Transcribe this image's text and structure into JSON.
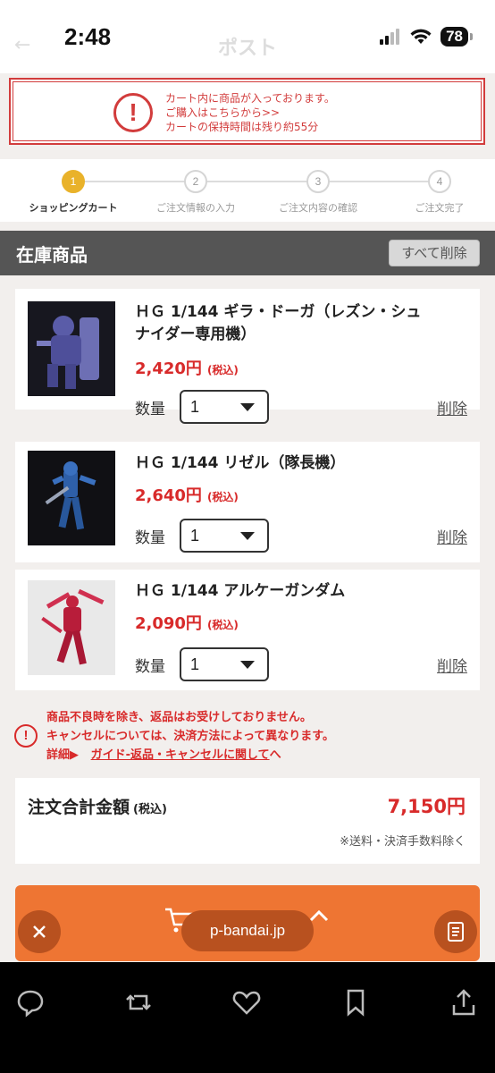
{
  "status_bar": {
    "time": "2:48",
    "battery": "78",
    "ghost_title": "ポスト",
    "icons": [
      "signal-icon",
      "wifi-icon",
      "battery-icon"
    ]
  },
  "alert": {
    "icon": "exclamation-icon",
    "lines": [
      "カート内に商品が入っております。",
      "ご購入はこちらから>>",
      "カートの保持時間は残り約55分"
    ],
    "color": "#d23c3c"
  },
  "steps": [
    {
      "num": "1",
      "label": "ショッピングカート",
      "active": true
    },
    {
      "num": "2",
      "label": "ご注文情報の入力",
      "active": false
    },
    {
      "num": "3",
      "label": "ご注文内容の確認",
      "active": false
    },
    {
      "num": "4",
      "label": "ご注文完了",
      "active": false
    }
  ],
  "section": {
    "title": "在庫商品",
    "delete_all": "すべて削除"
  },
  "items": [
    {
      "name_line1": "ＨＧ 1/144 ギラ・ドーガ（レズン・シュ",
      "name_line2": "ナイダー専用機）",
      "price": "2,420円",
      "tax": "(税込)",
      "qty_label": "数量",
      "qty": "1",
      "delete": "削除"
    },
    {
      "name_line1": "ＨＧ 1/144 リゼル（隊長機）",
      "name_line2": "",
      "price": "2,640円",
      "tax": "(税込)",
      "qty_label": "数量",
      "qty": "1",
      "delete": "削除"
    },
    {
      "name_line1": "ＨＧ 1/144 アルケーガンダム",
      "name_line2": "",
      "price": "2,090円",
      "tax": "(税込)",
      "qty_label": "数量",
      "qty": "1",
      "delete": "削除"
    }
  ],
  "notice": {
    "line1": "商品不良時を除き、返品はお受けしておりません。",
    "line2": "キャンセルについては、決済方法によって異なります。",
    "detail_label": "詳細▶",
    "link_text": "ガイド-返品・キャンセルに関して",
    "link_suffix": "へ"
  },
  "total": {
    "label": "注文合計金額",
    "tax": "(税込)",
    "value": "7,150円",
    "note": "※送料・決済手数料除く"
  },
  "browser": {
    "url": "p-bandai.jp"
  },
  "colors": {
    "accent_red": "#d82a2a",
    "orange": "#ee7533",
    "step_active": "#e9b22a"
  }
}
